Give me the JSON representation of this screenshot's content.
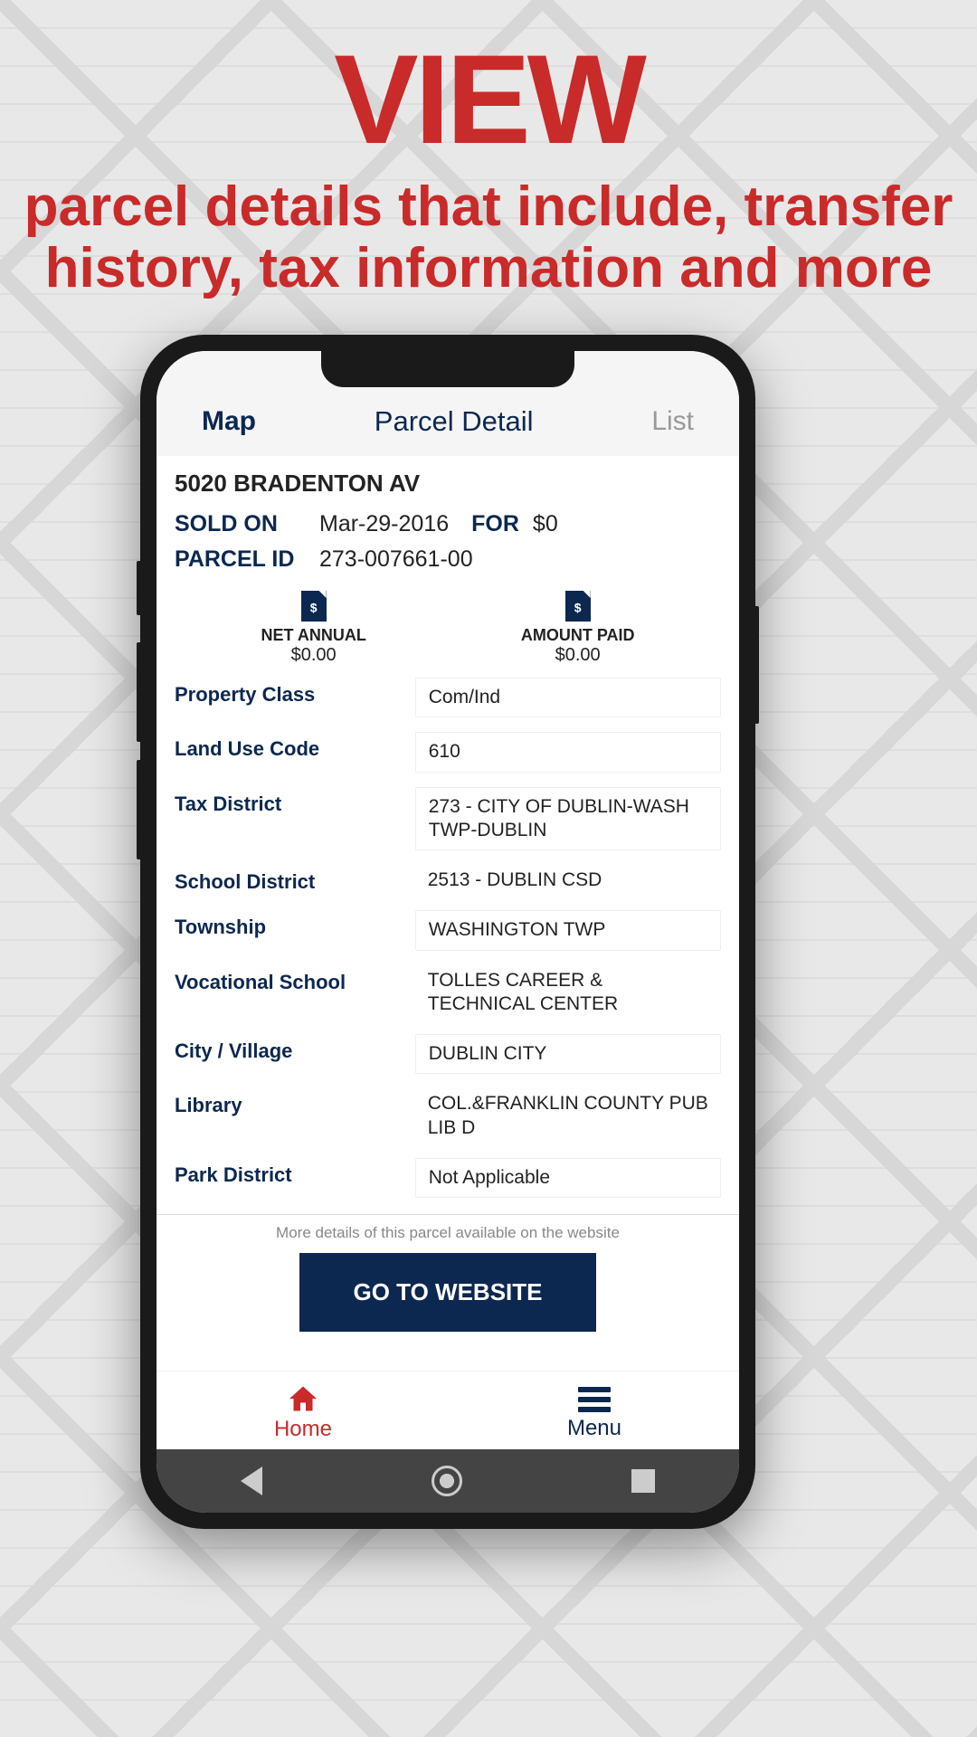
{
  "promo": {
    "title": "VIEW",
    "subtitle": "parcel details that include, transfer history, tax information and more"
  },
  "tabs": {
    "left": "Map",
    "center": "Parcel Detail",
    "right": "List"
  },
  "address": "5020 BRADENTON AV",
  "sold": {
    "label": "SOLD ON",
    "date": "Mar-29-2016",
    "forLabel": "FOR",
    "price": "$0"
  },
  "parcel": {
    "label": "PARCEL ID",
    "id": "273-007661-00"
  },
  "docs": {
    "netAnnual": {
      "label": "NET ANNUAL",
      "value": "$0.00"
    },
    "amountPaid": {
      "label": "AMOUNT PAID",
      "value": "$0.00"
    }
  },
  "details": [
    {
      "label": "Property Class",
      "value": "Com/Ind",
      "boxed": true
    },
    {
      "label": "Land Use Code",
      "value": "610",
      "boxed": true
    },
    {
      "label": "Tax District",
      "value": "273 - CITY OF DUBLIN-WASH TWP-DUBLIN",
      "boxed": true
    },
    {
      "label": "School District",
      "value": "2513 - DUBLIN CSD",
      "boxed": false
    },
    {
      "label": "Township",
      "value": "WASHINGTON TWP",
      "boxed": true
    },
    {
      "label": "Vocational School",
      "value": "TOLLES CAREER & TECHNICAL CENTER",
      "boxed": false
    },
    {
      "label": "City / Village",
      "value": "DUBLIN CITY",
      "boxed": true
    },
    {
      "label": "Library",
      "value": "COL.&FRANKLIN COUNTY PUB LIB D",
      "boxed": false
    },
    {
      "label": "Park District",
      "value": "Not Applicable",
      "boxed": true
    }
  ],
  "moreText": "More details of this parcel available on the website",
  "gotoBtn": "GO TO WEBSITE",
  "nav": {
    "home": "Home",
    "menu": "Menu"
  }
}
